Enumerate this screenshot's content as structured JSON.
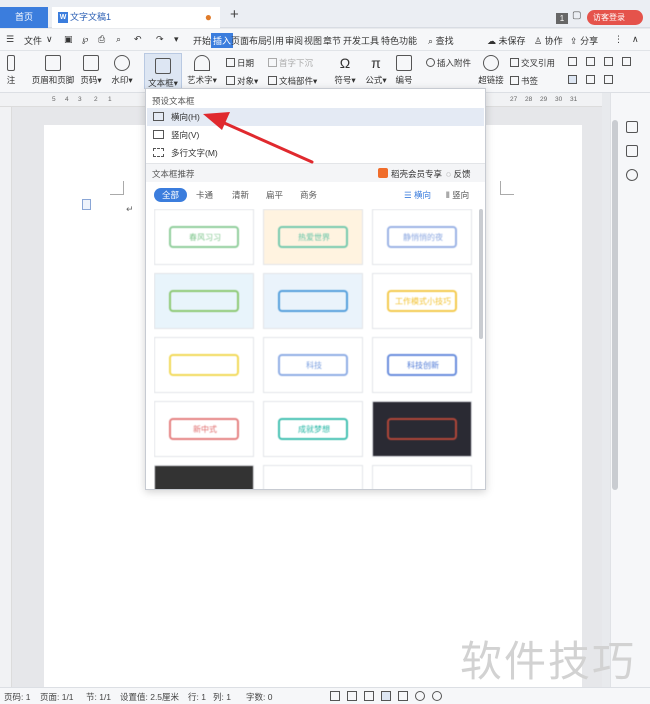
{
  "tabs": {
    "home": "首页",
    "document": "文字文稿1",
    "add": "+",
    "window_count": "1",
    "visitor": "访客登录"
  },
  "menubar": {
    "file": "文件",
    "items": [
      "开始",
      "插入",
      "页面布局",
      "引用",
      "审阅",
      "视图",
      "章节",
      "开发工具",
      "特色功能"
    ],
    "active": "插入",
    "search": "查找",
    "unsaved": "未保存",
    "collab": "协作",
    "share": "分享"
  },
  "ribbon": {
    "note": "注",
    "header_footer": "页眉和页脚",
    "page_num": "页码",
    "watermark": "水印",
    "textbox": "文本框",
    "art_text": "艺术字",
    "date": "日期",
    "first_drop": "首字下沉",
    "object": "对象",
    "doc_part": "文档部件",
    "symbol": "符号",
    "formula": "公式",
    "number": "编号",
    "attachment": "插入附件",
    "hyperlink": "超链接",
    "cross_ref": "交叉引用",
    "bookmark": "书签"
  },
  "ruler": {
    "left_ticks": [
      "5",
      "4",
      "3",
      "2",
      "1"
    ],
    "right_ticks": [
      "27",
      "28",
      "29",
      "30",
      "31"
    ]
  },
  "dropdown": {
    "preset_title": "预设文本框",
    "items": [
      {
        "label": "横向(H)",
        "hover": true
      },
      {
        "label": "竖向(V)",
        "hover": false
      },
      {
        "label": "多行文字(M)",
        "hover": false
      }
    ],
    "recommend_title": "文本框推荐",
    "vip_label": "稻壳会员专享",
    "feedback": "反馈",
    "filters": [
      "全部",
      "卡通",
      "清新",
      "扁平",
      "商务"
    ],
    "orient_h": "横向",
    "orient_v": "竖向",
    "cards": [
      {
        "bg": "#ffffff",
        "accent": "#7cc58a",
        "text": "春风习习"
      },
      {
        "bg": "#fff3e0",
        "accent": "#5ec2a4",
        "text": "热爱世界"
      },
      {
        "bg": "#ffffff",
        "accent": "#8aa6e0",
        "text": "静悄悄的夜"
      },
      {
        "bg": "#e8f4fb",
        "accent": "#7bbf5a",
        "text": ""
      },
      {
        "bg": "#eaf3fb",
        "accent": "#3a8fd6",
        "text": ""
      },
      {
        "bg": "#ffffff",
        "accent": "#f2c12e",
        "text": "工作模式小技巧"
      },
      {
        "bg": "#ffffff",
        "accent": "#f0d23a",
        "text": ""
      },
      {
        "bg": "#ffffff",
        "accent": "#7a9fe0",
        "text": "科技"
      },
      {
        "bg": "#ffffff",
        "accent": "#4e79d6",
        "text": "科技创新"
      },
      {
        "bg": "#ffffff",
        "accent": "#e06a6a",
        "text": "新中式"
      },
      {
        "bg": "#ffffff",
        "accent": "#20b5a3",
        "text": "成就梦想"
      },
      {
        "bg": "#2a2a33",
        "accent": "#c84a3a",
        "text": ""
      }
    ]
  },
  "statusbar": {
    "page_num": "页码: 1",
    "pages": "页面: 1/1",
    "section": "节: 1/1",
    "settings": "设置值: 2.5厘米",
    "row": "行: 1",
    "col": "列: 1",
    "words": "字数: 0"
  },
  "watermark_text": "软件技巧",
  "colors": {
    "accent": "#3b7ddd",
    "arrow": "#e0292e",
    "visitor": "#e5534b"
  }
}
